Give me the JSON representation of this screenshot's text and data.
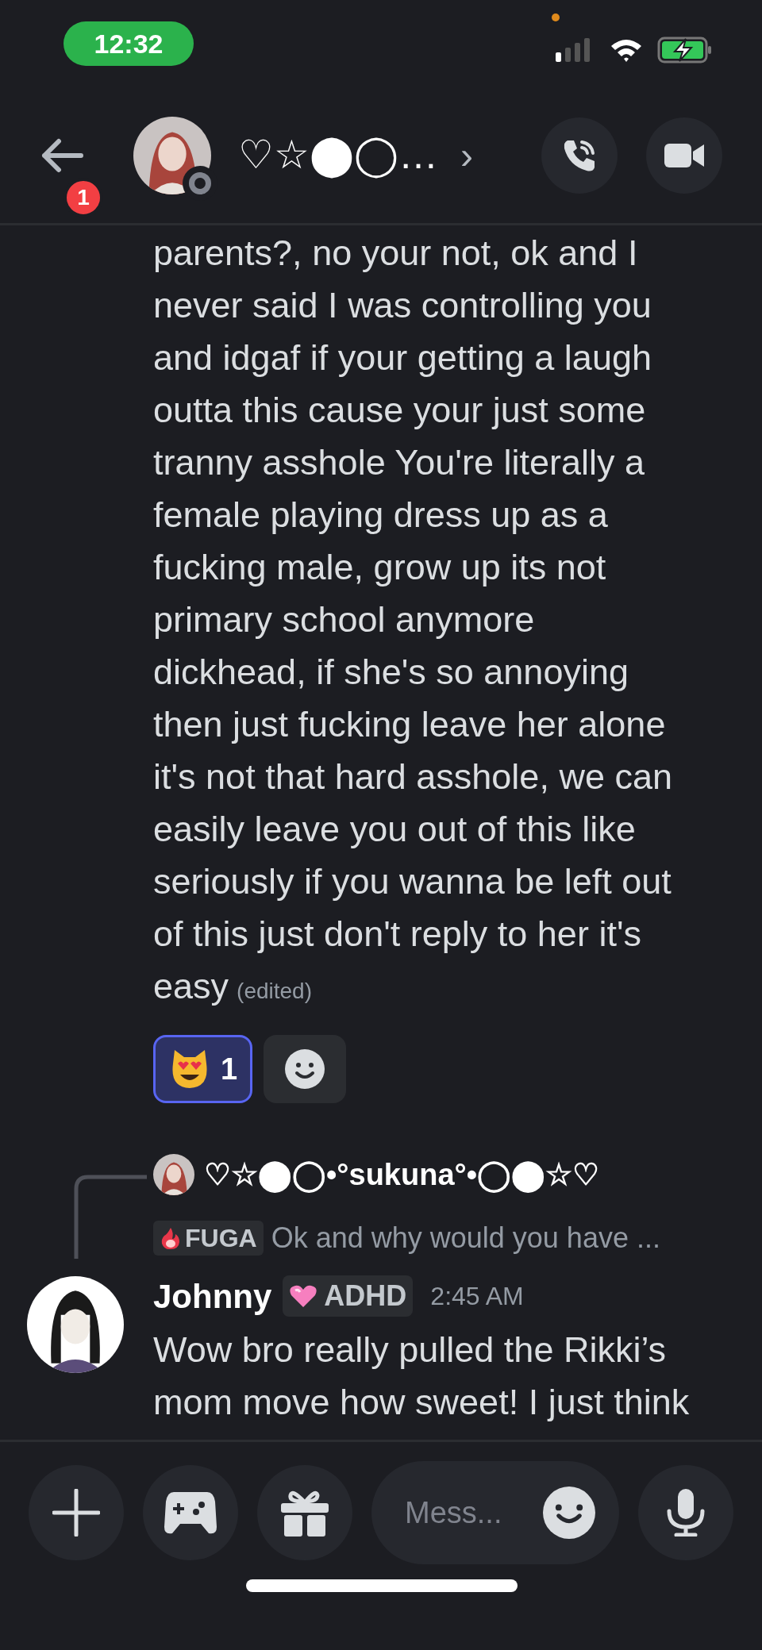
{
  "status_bar": {
    "time": "12:32"
  },
  "header": {
    "title": "♡☆⬤◯…",
    "unread_badge": "1",
    "chevron": "›"
  },
  "message": {
    "lines": [
      "parents?, no your not, ok and I",
      "never said I was controlling you",
      "and idgaf if your getting a laugh",
      "outta this cause your just some",
      "tranny asshole You're literally a",
      "female playing dress up as a",
      "fucking male, grow up its not",
      "primary school anymore",
      "dickhead, if she's so annoying",
      "then just fucking leave her alone",
      "it's not that hard asshole, we can",
      "easily leave you out of this like",
      "seriously if you wanna be left out",
      "of this just don't reply to her it's",
      "easy"
    ],
    "edited": "(edited)",
    "reactions": [
      {
        "kind": "emoji",
        "count": "1",
        "selected": true
      },
      {
        "kind": "add"
      }
    ]
  },
  "reply": {
    "author": "♡☆⬤◯•°sukuna°•◯⬤☆♡",
    "tag": "FUGA",
    "preview": "Ok and why would you have ..."
  },
  "next_message": {
    "author": "Johnny",
    "tag": "ADHD",
    "time": "2:45 AM",
    "lines": [
      "Wow bro really pulled the Rikki’s",
      "mom move how sweet! I just think"
    ]
  },
  "composer": {
    "placeholder": "Mess..."
  }
}
